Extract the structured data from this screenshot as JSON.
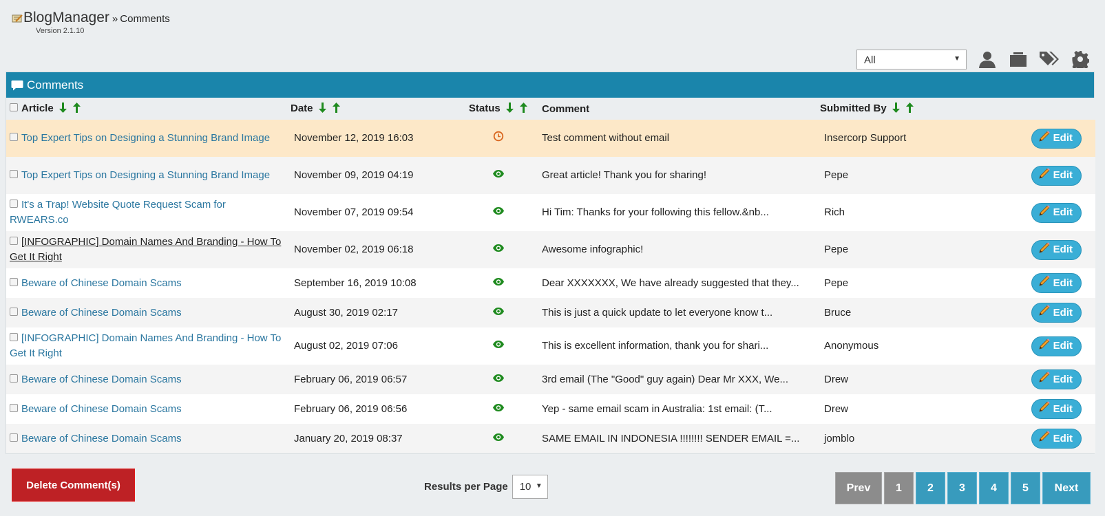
{
  "app": {
    "title": "BlogManager",
    "breadcrumb_sep": "»",
    "breadcrumb": "Comments",
    "version": "Version 2.1.10"
  },
  "toolbar": {
    "filter_value": "All",
    "icons": [
      "user-icon",
      "folder-icon",
      "tags-icon",
      "gear-icon"
    ]
  },
  "panel": {
    "title": "Comments",
    "columns": {
      "article": "Article",
      "date": "Date",
      "status": "Status",
      "comment": "Comment",
      "submitted_by": "Submitted By"
    }
  },
  "colors": {
    "accent": "#1a85ab",
    "link": "#2b77a0",
    "pending_row": "#fde8c8",
    "approved_icon": "#1e8a1e",
    "pending_icon": "#d9661f",
    "delete": "#be2125",
    "edit": "#3aaed6"
  },
  "rows": [
    {
      "article": "Top Expert Tips on Designing a Stunning Brand Image",
      "date": "November 12, 2019 16:03",
      "status": "pending",
      "comment": "Test comment without email",
      "submitted_by": "Insercorp Support",
      "edit": "Edit"
    },
    {
      "article": "Top Expert Tips on Designing a Stunning Brand Image",
      "date": "November 09, 2019 04:19",
      "status": "approved",
      "comment": "Great article!  Thank you for sharing!",
      "submitted_by": "Pepe",
      "edit": "Edit"
    },
    {
      "article": "It's a Trap! Website Quote Request Scam for RWEARS.co",
      "date": "November 07, 2019 09:54",
      "status": "approved",
      "comment": "Hi Tim: Thanks for your following this fellow.&nb...",
      "submitted_by": "Rich",
      "edit": "Edit"
    },
    {
      "article": "[INFOGRAPHIC] Domain Names And Branding - How To Get It Right",
      "date": "November 02, 2019 06:18",
      "status": "approved",
      "comment": "Awesome infographic!",
      "submitted_by": "Pepe",
      "edit": "Edit"
    },
    {
      "article": "Beware of Chinese Domain Scams",
      "date": "September 16, 2019 10:08",
      "status": "approved",
      "comment": "Dear XXXXXXX, We have already suggested that they...",
      "submitted_by": "Pepe",
      "edit": "Edit"
    },
    {
      "article": "Beware of Chinese Domain Scams",
      "date": "August 30, 2019 02:17",
      "status": "approved",
      "comment": "This is just a quick update to let everyone know t...",
      "submitted_by": "Bruce",
      "edit": "Edit"
    },
    {
      "article": "[INFOGRAPHIC] Domain Names And Branding - How To Get It Right",
      "date": "August 02, 2019 07:06",
      "status": "approved",
      "comment": "This is excellent information, thank you for shari...",
      "submitted_by": "Anonymous",
      "edit": "Edit"
    },
    {
      "article": "Beware of Chinese Domain Scams",
      "date": "February 06, 2019 06:57",
      "status": "approved",
      "comment": "3rd email (The \"Good\" guy again) Dear Mr XXX, We...",
      "submitted_by": "Drew",
      "edit": "Edit"
    },
    {
      "article": "Beware of Chinese Domain Scams",
      "date": "February 06, 2019 06:56",
      "status": "approved",
      "comment": "Yep - same email scam in Australia: 1st email: (T...",
      "submitted_by": "Drew",
      "edit": "Edit"
    },
    {
      "article": "Beware of Chinese Domain Scams",
      "date": "January 20, 2019 08:37",
      "status": "approved",
      "comment": "SAME EMAIL IN INDONESIA !!!!!!!! SENDER EMAIL =...",
      "submitted_by": "jomblo",
      "edit": "Edit"
    }
  ],
  "footer": {
    "delete_label": "Delete Comment(s)",
    "results_per_page_label": "Results per Page",
    "results_per_page_value": "10",
    "pagination": {
      "prev": "Prev",
      "next": "Next",
      "pages": [
        "1",
        "2",
        "3",
        "4",
        "5"
      ],
      "current": "1"
    }
  }
}
